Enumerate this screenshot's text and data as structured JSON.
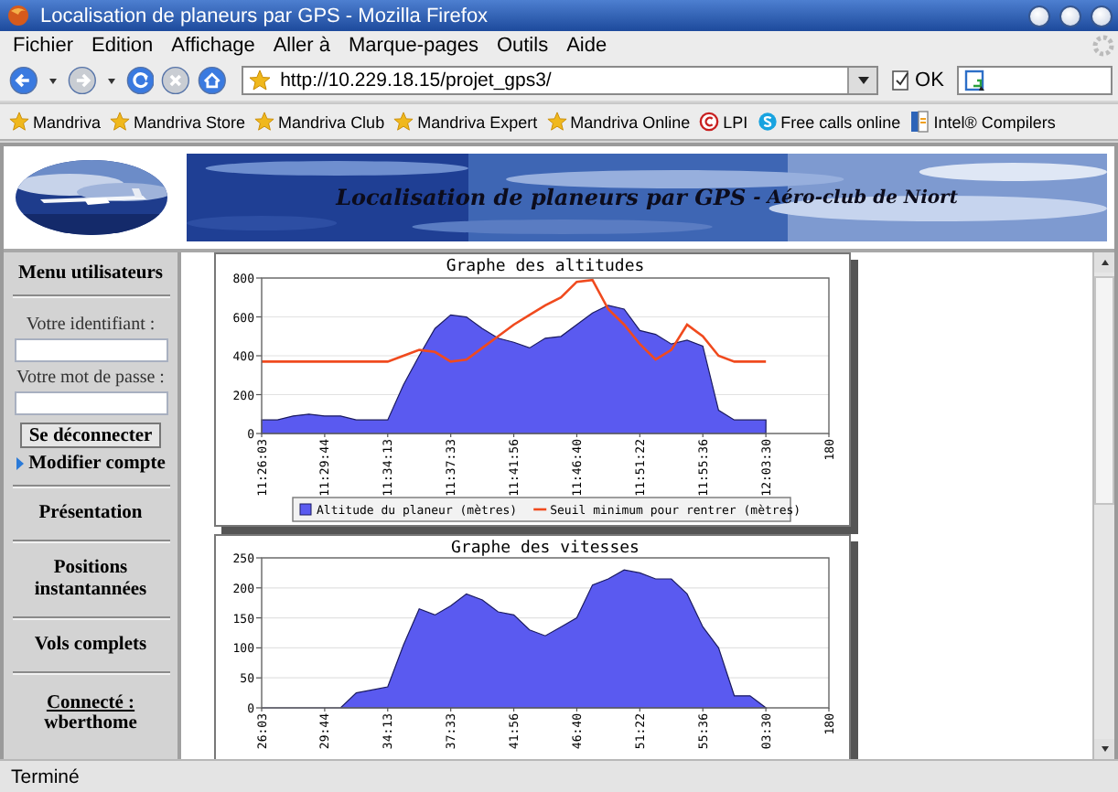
{
  "window": {
    "title": "Localisation de planeurs par GPS - Mozilla Firefox"
  },
  "menu_bar": [
    "Fichier",
    "Edition",
    "Affichage",
    "Aller à",
    "Marque-pages",
    "Outils",
    "Aide"
  ],
  "toolbar": {
    "url": "http://10.229.18.15/projet_gps3/",
    "go_button": "OK"
  },
  "bookmarks": [
    {
      "label": "Mandriva",
      "kind": "star"
    },
    {
      "label": "Mandriva Store",
      "kind": "star"
    },
    {
      "label": "Mandriva Club",
      "kind": "star"
    },
    {
      "label": "Mandriva Expert",
      "kind": "star"
    },
    {
      "label": "Mandriva Online",
      "kind": "star"
    },
    {
      "label": "LPI",
      "kind": "lpi"
    },
    {
      "label": "Free calls online",
      "kind": "phone"
    },
    {
      "label": "Intel® Compilers",
      "kind": "intel"
    }
  ],
  "header": {
    "title": "Localisation de planeurs par GPS",
    "subtitle": "- Aéro-club de Niort"
  },
  "sidebar": {
    "heading": "Menu utilisateurs",
    "login_label": "Votre identifiant :",
    "password_label": "Votre mot de passe :",
    "logout_button": "Se déconnecter",
    "account_link": "Modifier compte",
    "links": [
      "Présentation",
      "Positions instantannées",
      "Vols complets"
    ],
    "connected_label": "Connecté :",
    "user": "wberthome"
  },
  "charts": [
    {
      "chart_data": {
        "type": "area",
        "title": "Graphe des altitudes",
        "categories": [
          "11:26:03",
          null,
          null,
          null,
          "11:29:44",
          null,
          null,
          null,
          "11:34:13",
          null,
          null,
          null,
          "11:37:33",
          null,
          null,
          null,
          "11:41:56",
          null,
          null,
          null,
          "11:46:40",
          null,
          null,
          null,
          "11:51:22",
          null,
          null,
          null,
          "11:55:36",
          null,
          null,
          null,
          "12:03:30",
          null,
          null,
          null,
          "180"
        ],
        "series": [
          {
            "name": "Altitude du planeur (mètres)",
            "color": "#5a5af0",
            "type": "area",
            "values": [
              70,
              70,
              90,
              100,
              90,
              90,
              70,
              70,
              70,
              250,
              400,
              540,
              610,
              600,
              540,
              490,
              470,
              440,
              490,
              500,
              560,
              620,
              660,
              640,
              530,
              510,
              460,
              480,
              450,
              120,
              70,
              70,
              70,
              null,
              null,
              null,
              null
            ]
          },
          {
            "name": "Seuil minimum pour rentrer (mètres)",
            "color": "#f04a1e",
            "type": "line",
            "values": [
              370,
              370,
              370,
              370,
              370,
              370,
              370,
              370,
              370,
              400,
              430,
              420,
              370,
              380,
              440,
              500,
              560,
              610,
              660,
              700,
              780,
              790,
              640,
              560,
              460,
              380,
              430,
              560,
              500,
              400,
              370,
              370,
              370,
              null,
              null,
              null,
              null
            ]
          }
        ],
        "ylim": [
          0,
          800
        ],
        "yticks": [
          0,
          200,
          400,
          600,
          800
        ],
        "grid": true,
        "legend": true
      }
    },
    {
      "chart_data": {
        "type": "area",
        "title": "Graphe des vitesses",
        "categories": [
          "26:03",
          null,
          null,
          null,
          "29:44",
          null,
          null,
          null,
          "34:13",
          null,
          null,
          null,
          "37:33",
          null,
          null,
          null,
          "41:56",
          null,
          null,
          null,
          "46:40",
          null,
          null,
          null,
          "51:22",
          null,
          null,
          null,
          "55:36",
          null,
          null,
          null,
          "03:30",
          null,
          null,
          null,
          "180"
        ],
        "series": [
          {
            "color": "#5a5af0",
            "type": "area",
            "values": [
              0,
              0,
              0,
              0,
              0,
              0,
              25,
              30,
              35,
              105,
              165,
              155,
              170,
              190,
              180,
              160,
              155,
              130,
              120,
              135,
              150,
              205,
              215,
              230,
              225,
              215,
              215,
              190,
              135,
              100,
              20,
              20,
              0,
              null,
              null,
              null,
              null
            ]
          }
        ],
        "ylim": [
          0,
          250
        ],
        "yticks": [
          0,
          50,
          100,
          150,
          200,
          250
        ],
        "grid": true
      }
    }
  ],
  "status_bar": "Terminé"
}
